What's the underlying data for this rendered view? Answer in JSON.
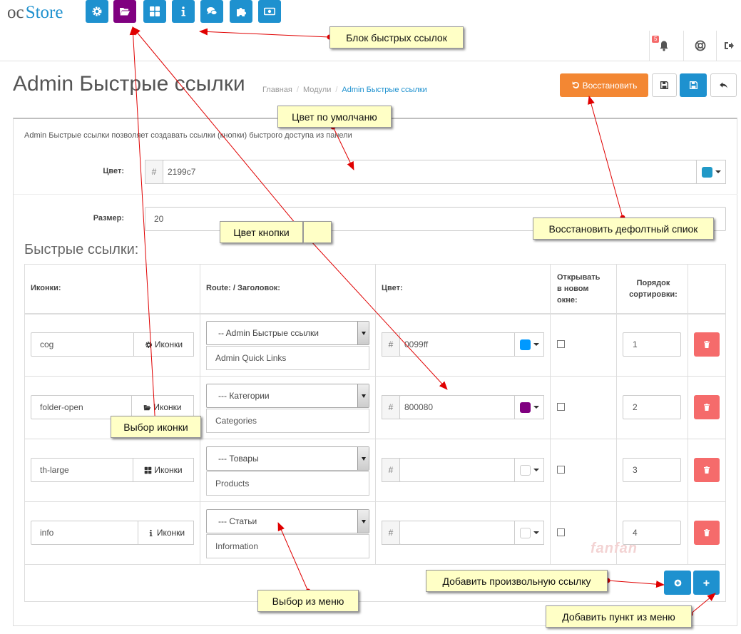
{
  "header": {
    "logo_oc": "oc",
    "logo_store": "Store",
    "quick_links": [
      {
        "icon": "cog-icon",
        "color": "#1e91cf"
      },
      {
        "icon": "folder-open-icon",
        "color": "#800080"
      },
      {
        "icon": "th-large-icon",
        "color": "#1e91cf"
      },
      {
        "icon": "info-icon",
        "color": "#1e91cf"
      },
      {
        "icon": "comments-icon",
        "color": "#1e91cf"
      },
      {
        "icon": "puzzle-icon",
        "color": "#1e91cf"
      },
      {
        "icon": "money-icon",
        "color": "#1e91cf"
      }
    ],
    "notification_count": "5"
  },
  "page": {
    "title": "Admin Быстрые ссылки",
    "breadcrumb": [
      "Главная",
      "Модули",
      "Admin Быстрые ссылки"
    ],
    "restore_label": "Восстановить",
    "restore_color": "#f38733",
    "save_color": "#1e91cf"
  },
  "form": {
    "description": "Admin Быстрые ссылки позволяет создавать ссылки (кнопки) быстрого доступа из панели",
    "color_label": "Цвет:",
    "color_prefix": "#",
    "color_value": "2199c7",
    "color_swatch": "#2199c7",
    "size_label": "Размер:",
    "size_value": "20"
  },
  "links": {
    "section_title": "Быстрые ссылки:",
    "headers": {
      "icons": "Иконки:",
      "route": "Route: / Заголовок:",
      "color": "Цвет:",
      "new_window": [
        "Открывать",
        "в новом",
        "окне:"
      ],
      "sort": [
        "Порядок",
        "сортировки:"
      ]
    },
    "icon_button_label": "Иконки",
    "rows": [
      {
        "icon": "cog",
        "icon_glyph": "cog-icon",
        "route": "-- Admin Быстрые ссылки",
        "title": "Admin Quick Links",
        "color": "0099ff",
        "swatch": "#0099ff",
        "sort": "1"
      },
      {
        "icon": "folder-open",
        "icon_glyph": "folder-open-icon",
        "route": "--- Категории",
        "title": "Categories",
        "color": "800080",
        "swatch": "#800080",
        "sort": "2"
      },
      {
        "icon": "th-large",
        "icon_glyph": "th-large-icon",
        "route": "--- Товары",
        "title": "Products",
        "color": "",
        "swatch": "#ffffff",
        "sort": "3"
      },
      {
        "icon": "info",
        "icon_glyph": "info-icon",
        "route": "--- Статьи",
        "title": "Information",
        "color": "",
        "swatch": "#ffffff",
        "sort": "4"
      }
    ]
  },
  "annotations": {
    "quick_links_block": "Блок быстрых ссылок",
    "default_color": "Цвет по умолчаню",
    "restore_default": "Восстановить дефолтный спиок",
    "button_color": "Цвет кнопки",
    "icon_choice": "Выбор иконки",
    "menu_choice": "Выбор из меню",
    "add_custom": "Добавить произвольную ссылку",
    "add_menu_item": "Добавить пункт из меню",
    "watermark": "fanfan"
  }
}
